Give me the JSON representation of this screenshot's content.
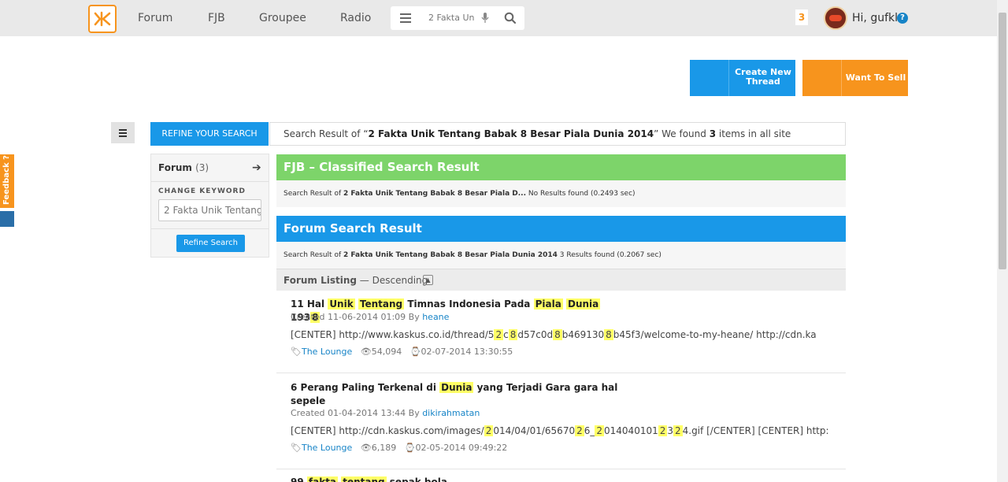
{
  "header": {
    "nav": [
      "Forum",
      "FJB",
      "Groupee",
      "Radio"
    ],
    "search_value": "2 Fakta Un",
    "notifications": "3",
    "greeting": "Hi, gufkl",
    "help": "?"
  },
  "actions": {
    "create_thread": "Create New Thread",
    "want_to_sell": "Want To Sell"
  },
  "feedback": "Feedback ?",
  "refine": {
    "tab_label": "REFINE YOUR SEARCH",
    "result_prefix": "Search Result of “",
    "query": "2 Fakta Unik Tentang Babak 8 Besar Piala Dunia 2014",
    "result_mid": "” We found ",
    "count": "3",
    "result_suffix": " items in all site"
  },
  "sidebar": {
    "forum_label": "Forum",
    "forum_count": "(3)",
    "change_keyword": "CHANGE KEYWORD",
    "keyword_value": "2 Fakta Unik Tentang",
    "refine_button": "Refine Search"
  },
  "fjb": {
    "title": "FJB – Classified Search Result",
    "line_prefix": "Search Result of ",
    "line_query": "2 Fakta Unik Tentang Babak 8 Besar Piala D...",
    "line_suffix": "  No Results found (0.2493 sec)"
  },
  "forum": {
    "title": "Forum Search Result",
    "line_prefix": "Search Result of ",
    "line_query": "2 Fakta Unik Tentang Babak 8 Besar Piala Dunia 2014",
    "line_suffix": " 3 Results found (0.2067 sec)",
    "listing_label": "Forum Listing",
    "listing_order": " — Descending"
  },
  "threads": [
    {
      "created": "Created 11-06-2014 01:09 By ",
      "author": "heane",
      "category": "The Lounge",
      "views": "54,094",
      "date": "02-07-2014 13:30:55"
    },
    {
      "created": "Created 01-04-2014 13:44 By ",
      "author": "dikirahmatan",
      "category": "The Lounge",
      "views": "6,189",
      "date": "02-05-2014 09:49:22"
    }
  ]
}
